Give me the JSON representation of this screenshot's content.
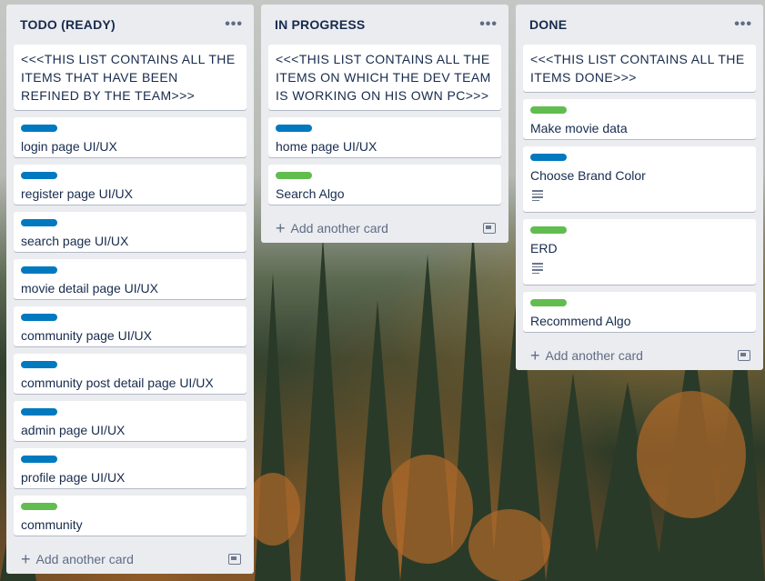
{
  "lists": [
    {
      "title": "TODO (READY)",
      "menu": "•••",
      "note": "<<<THIS LIST CONTAINS ALL THE ITEMS THAT HAVE BEEN REFINED BY THE TEAM>>>",
      "cards": [
        {
          "label": "blue",
          "text": "login page UI/UX"
        },
        {
          "label": "blue",
          "text": "register page UI/UX"
        },
        {
          "label": "blue",
          "text": "search page UI/UX"
        },
        {
          "label": "blue",
          "text": "movie detail page UI/UX"
        },
        {
          "label": "blue",
          "text": "community page UI/UX"
        },
        {
          "label": "blue",
          "text": "community post detail page UI/UX"
        },
        {
          "label": "blue",
          "text": "admin page UI/UX"
        },
        {
          "label": "blue",
          "text": "profile page UI/UX"
        },
        {
          "label": "green",
          "text": "community"
        }
      ],
      "add_label": "Add another card"
    },
    {
      "title": "IN PROGRESS",
      "menu": "•••",
      "note": "<<<THIS LIST CONTAINS ALL THE ITEMS ON WHICH THE DEV TEAM IS WORKING ON HIS OWN PC>>>",
      "cards": [
        {
          "label": "blue",
          "text": "home page UI/UX"
        },
        {
          "label": "green",
          "text": "Search Algo"
        }
      ],
      "add_label": "Add another card"
    },
    {
      "title": "DONE",
      "menu": "•••",
      "note": "<<<THIS LIST CONTAINS ALL THE ITEMS DONE>>>",
      "cards": [
        {
          "label": "green",
          "text": "Make movie data",
          "description": false
        },
        {
          "label": "blue",
          "text": "Choose Brand Color",
          "description": true
        },
        {
          "label": "green",
          "text": "ERD",
          "description": true
        },
        {
          "label": "green",
          "text": "Recommend Algo",
          "description": false
        }
      ],
      "add_label": "Add another card"
    }
  ],
  "colors": {
    "label_blue": "#0079bf",
    "label_green": "#61bd4f",
    "list_bg": "#ebecf0"
  }
}
